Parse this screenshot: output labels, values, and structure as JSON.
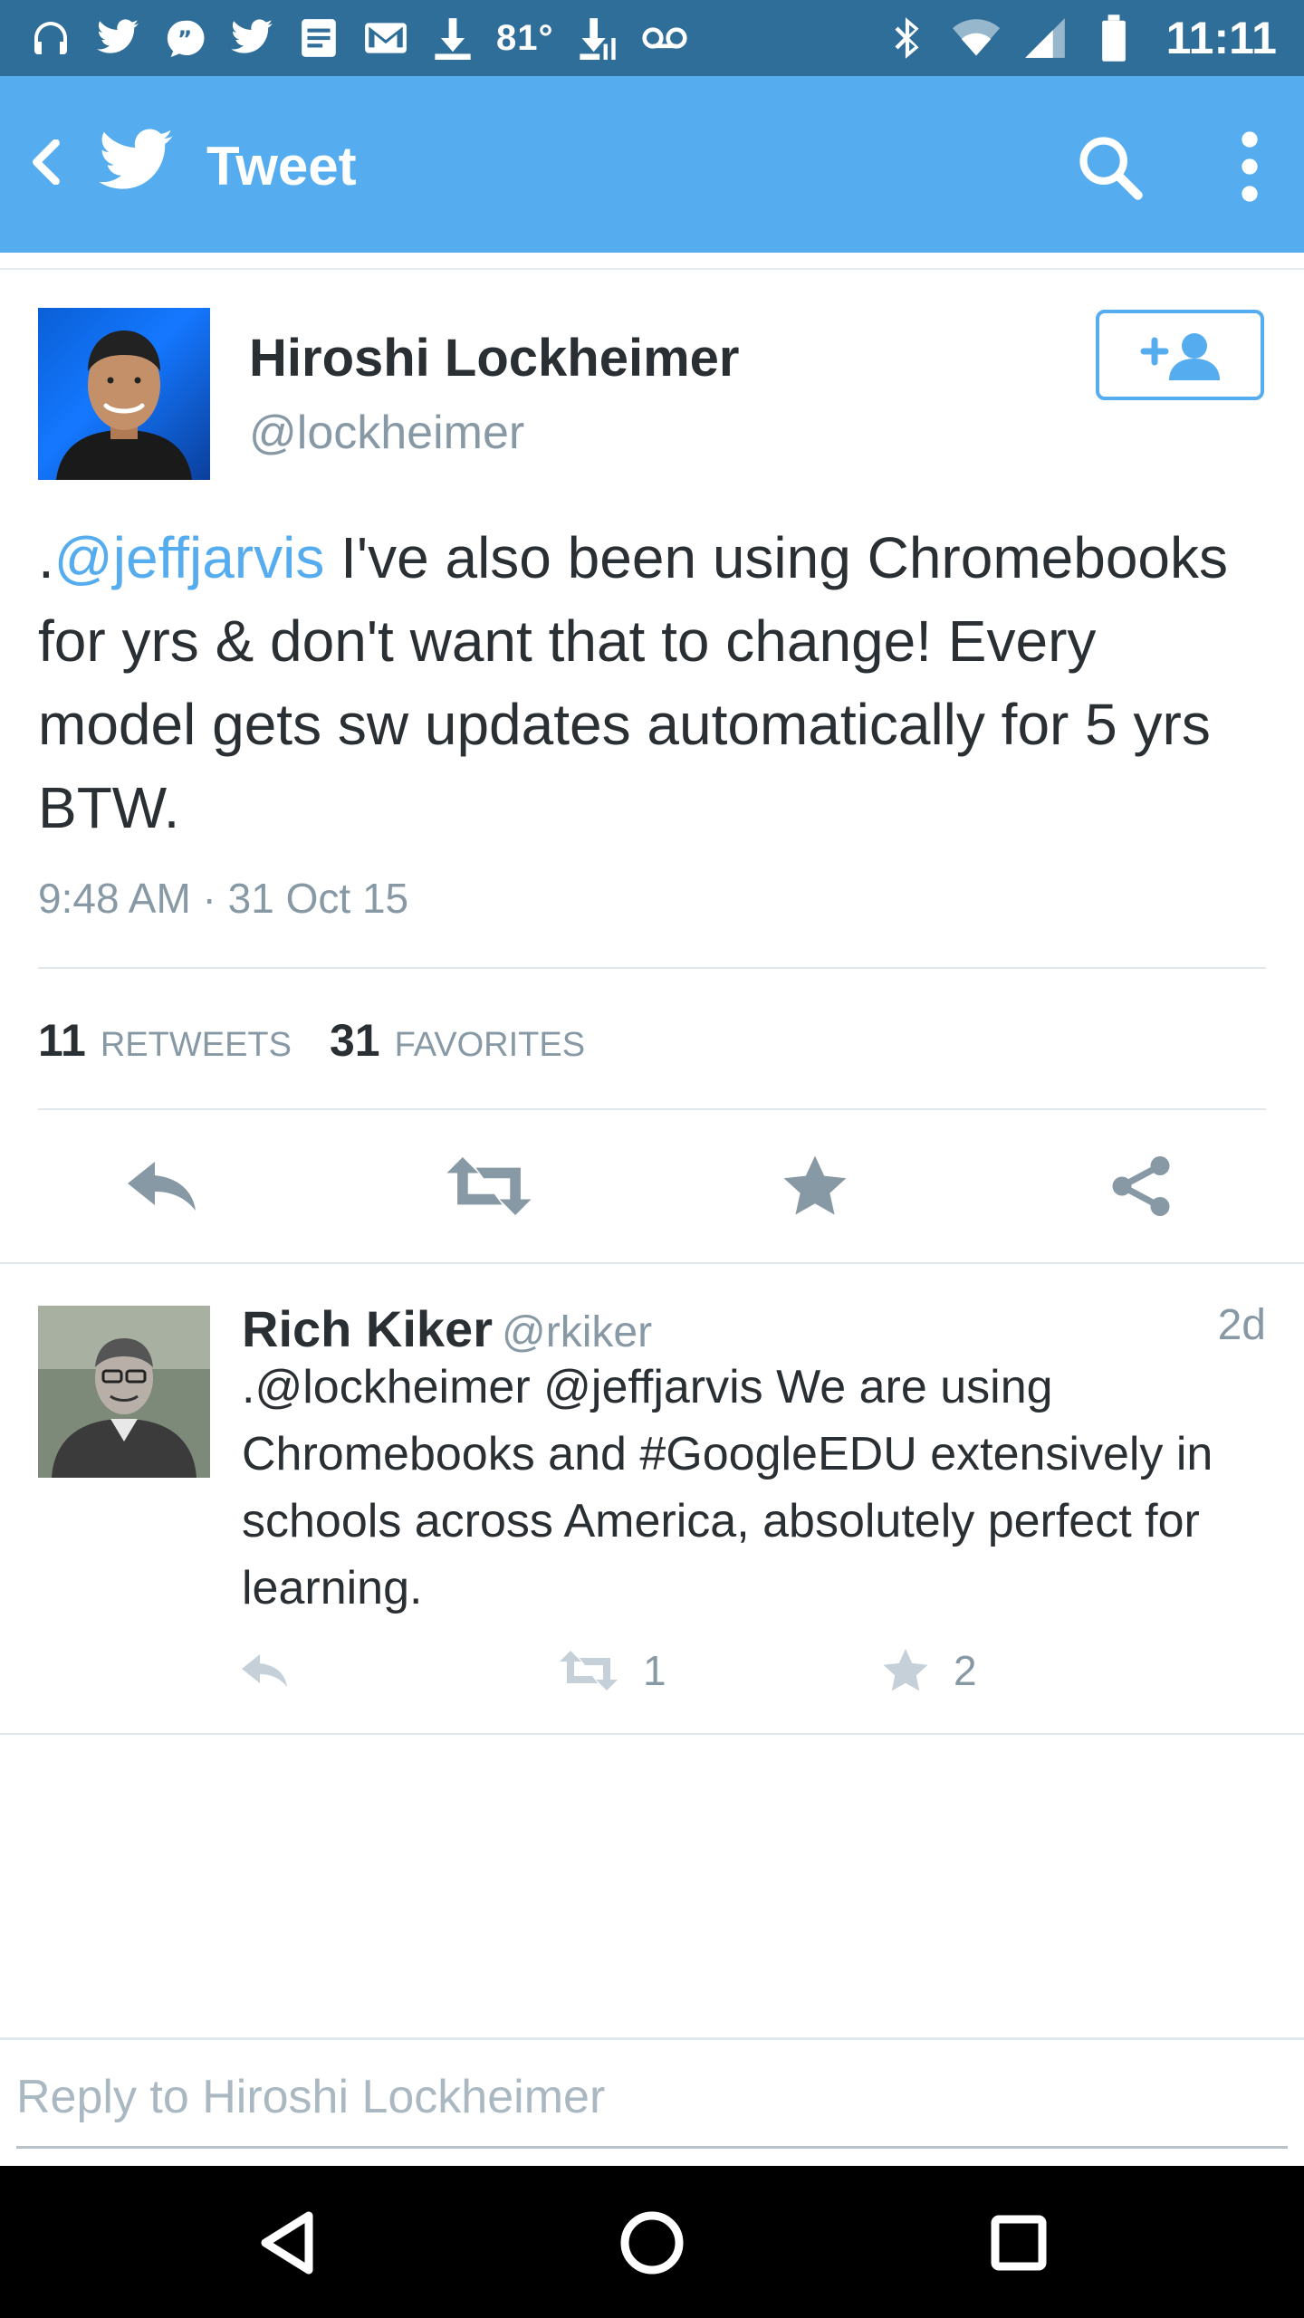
{
  "status_bar": {
    "temperature": "81°",
    "time": "11:11",
    "left_icons": [
      "headphones-icon",
      "twitter-icon",
      "quote-icon",
      "twitter-icon",
      "document-icon",
      "gmail-icon",
      "download-icon",
      "download-icon",
      "voicemail-icon"
    ],
    "right_icons": [
      "bluetooth-icon",
      "wifi-icon",
      "signal-icon",
      "battery-icon"
    ],
    "background": "#2f6e99"
  },
  "app_bar": {
    "title": "Tweet",
    "background": "#55acee"
  },
  "tweet": {
    "author_name": "Hiroshi Lockheimer",
    "author_handle": "@lockheimer",
    "text_prefix": ".",
    "mention": "@jeffjarvis",
    "text_body": " I've also been using Chromebooks for yrs & don't want that to change! Every model gets sw updates automatically for 5 yrs BTW.",
    "timestamp": "9:48 AM · 31 Oct 15",
    "retweets_count": "11",
    "retweets_label": "RETWEETS",
    "favorites_count": "31",
    "favorites_label": "FAVORITES"
  },
  "reply": {
    "author_name": "Rich Kiker",
    "author_handle": "@rkiker",
    "age": "2d",
    "text": ".@lockheimer @jeffjarvis We are using Chromebooks and #GoogleEDU extensively in schools across America, absolutely perfect for learning.",
    "retweet_count": "1",
    "favorite_count": "2"
  },
  "composer": {
    "placeholder": "Reply to Hiroshi Lockheimer"
  },
  "colors": {
    "accent": "#55acee",
    "text_primary": "#292f33",
    "text_secondary": "#8899a6",
    "icon_gray": "#8899a6"
  }
}
